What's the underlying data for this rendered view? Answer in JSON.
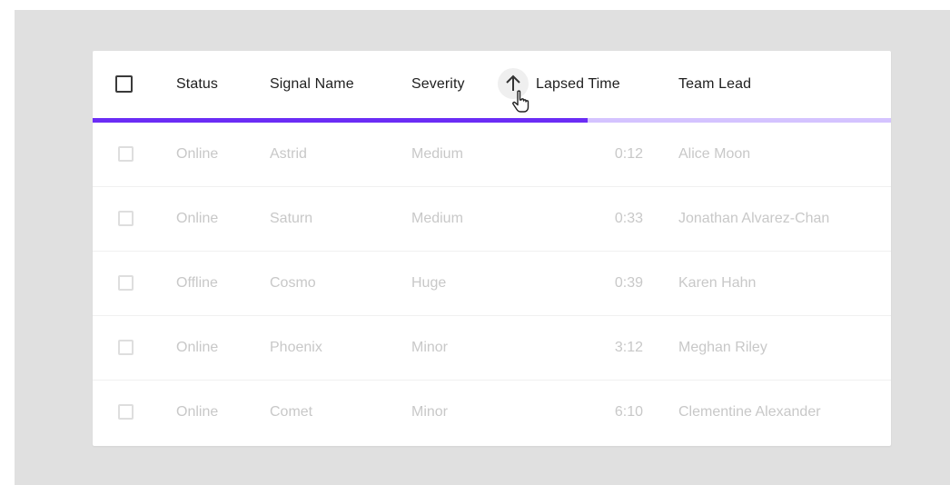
{
  "table": {
    "columns": {
      "status": "Status",
      "signal_name": "Signal Name",
      "severity": "Severity",
      "lapsed_time": "Lapsed Time",
      "team_lead": "Team Lead"
    },
    "sort_icon": "arrow-up-icon",
    "loading_progress_percent": 62,
    "rows": [
      {
        "status": "Online",
        "signal_name": "Astrid",
        "severity": "Medium",
        "lapsed_time": "0:12",
        "team_lead": "Alice Moon"
      },
      {
        "status": "Online",
        "signal_name": "Saturn",
        "severity": "Medium",
        "lapsed_time": "0:33",
        "team_lead": "Jonathan Alvarez-Chan"
      },
      {
        "status": "Offline",
        "signal_name": "Cosmo",
        "severity": "Huge",
        "lapsed_time": "0:39",
        "team_lead": "Karen Hahn"
      },
      {
        "status": "Online",
        "signal_name": "Phoenix",
        "severity": "Minor",
        "lapsed_time": "3:12",
        "team_lead": "Meghan Riley"
      },
      {
        "status": "Online",
        "signal_name": "Comet",
        "severity": "Minor",
        "lapsed_time": "6:10",
        "team_lead": "Clementine Alexander"
      }
    ]
  },
  "colors": {
    "accent": "#6b2cf5",
    "accent_track": "#d4c3ff",
    "backdrop": "#e0e0e0",
    "disabled_text": "#c8c8c8"
  }
}
